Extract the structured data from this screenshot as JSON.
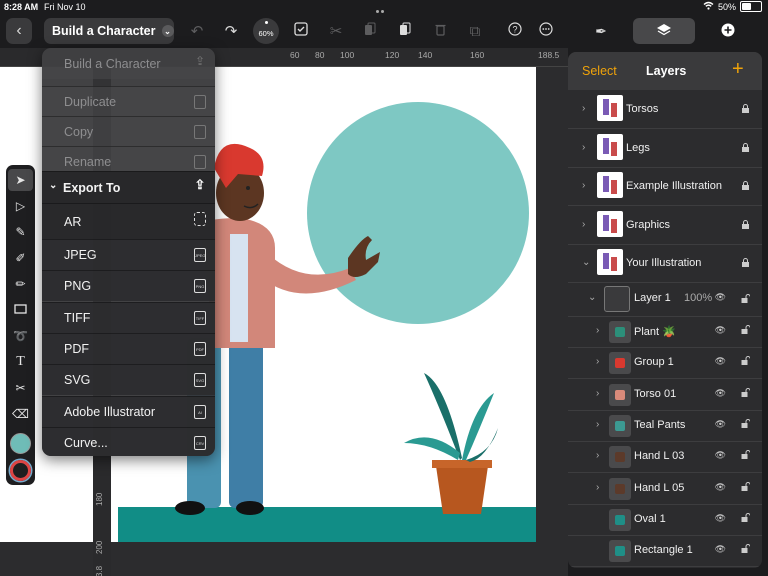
{
  "status": {
    "time": "8:28 AM",
    "date": "Fri Nov 10",
    "battery": "50%",
    "battery_level": 0.5
  },
  "toolbar": {
    "doc_title": "Build a Character",
    "zoom": "60%"
  },
  "rulers": {
    "h_ticks": [
      "60",
      "80",
      "100",
      "120",
      "140",
      "160",
      "188.5"
    ],
    "v_ticks": [
      "180",
      "200",
      "213.8"
    ]
  },
  "menu": {
    "title": "Build a Character",
    "items": [
      {
        "label": "Duplicate",
        "muted": true
      },
      {
        "label": "Copy",
        "muted": true
      },
      {
        "label": "Rename",
        "muted": true
      }
    ],
    "export_header": "Export To",
    "export_items": [
      {
        "label": "AR",
        "icon": "ar-icon",
        "badge": ""
      },
      {
        "label": "JPEG",
        "icon": "jpeg-file-icon",
        "badge": "JPEG"
      },
      {
        "label": "PNG",
        "icon": "png-file-icon",
        "badge": "PNG"
      },
      {
        "label": "TIFF",
        "icon": "tiff-file-icon",
        "badge": "TIFF"
      },
      {
        "label": "PDF",
        "icon": "pdf-file-icon",
        "badge": "PDF"
      },
      {
        "label": "SVG",
        "icon": "svg-file-icon",
        "badge": "SVG"
      },
      {
        "label": "Adobe Illustrator",
        "icon": "ai-file-icon",
        "badge": "AI"
      },
      {
        "label": "Curve...",
        "icon": "curve-file-icon",
        "badge": "CRV"
      }
    ]
  },
  "panel": {
    "select_label": "Select",
    "title": "Layers",
    "add_label": "+",
    "top_layers": [
      {
        "name": "Torsos"
      },
      {
        "name": "Legs"
      },
      {
        "name": "Example Illustration"
      },
      {
        "name": "Graphics"
      },
      {
        "name": "Your Illustration"
      }
    ],
    "layer1": {
      "name": "Layer 1",
      "opacity": "100%"
    },
    "sublayers": [
      {
        "name": "Plant 🪴",
        "color": "#2c8f7a"
      },
      {
        "name": "Group 1",
        "color": "#d9392f"
      },
      {
        "name": "Torso 01",
        "color": "#d98a7a"
      },
      {
        "name": "Teal Pants",
        "color": "#3c9a93"
      },
      {
        "name": "Hand L 03",
        "color": "#5c3a2a"
      },
      {
        "name": "Hand L 05",
        "color": "#5c3a2a"
      },
      {
        "name": "Oval 1",
        "color": "#1f8f87"
      },
      {
        "name": "Rectangle 1",
        "color": "#1f8f87"
      }
    ]
  },
  "colors": {
    "accent": "#f0a30a",
    "teal": "#7ec8c3",
    "ground": "#118d86",
    "fill_swatch": "#6fbcb7"
  }
}
